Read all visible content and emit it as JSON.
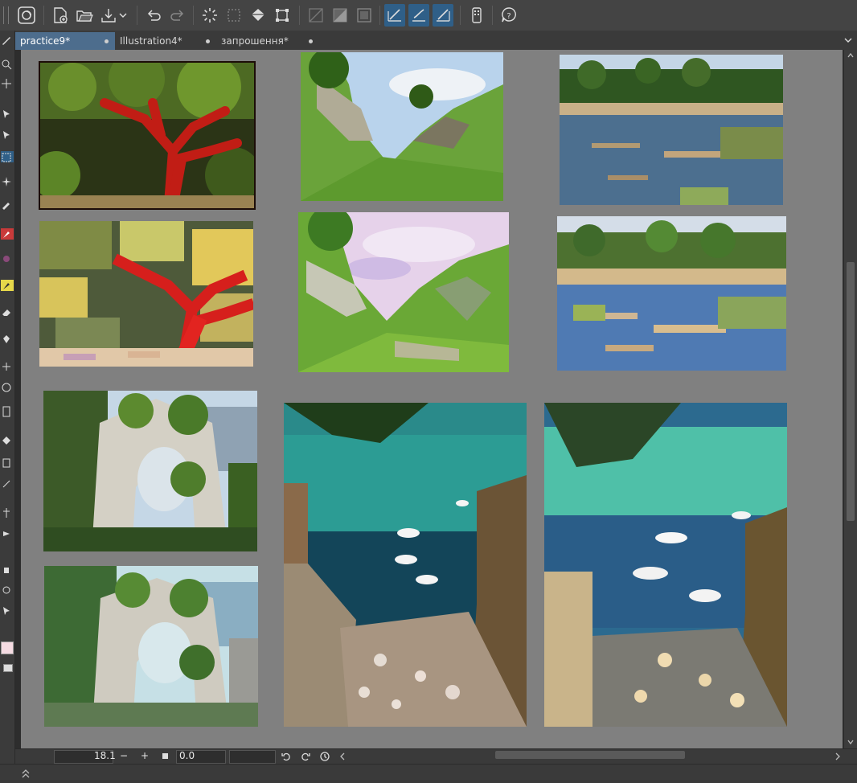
{
  "tabs": [
    {
      "label": "practice9*",
      "active": true
    },
    {
      "label": "Illustration4*",
      "active": false
    },
    {
      "label": "запрошення*",
      "active": false
    }
  ],
  "toolbar_icons": [
    "app-logo-icon",
    "new-file-icon",
    "open-file-icon",
    "save-file-icon",
    "dropdown-icon",
    "undo-icon",
    "redo-icon",
    "loading-icon",
    "selection-icon",
    "fill-icon",
    "transform-icon",
    "clear-selection-icon",
    "grey-tone-icon",
    "border-icon",
    "snap-ruler-icon",
    "snap-special-ruler-icon",
    "snap-grid-icon",
    "device-icon",
    "help-icon"
  ],
  "status": {
    "zoom": "18.1",
    "rotation": "0.0",
    "minus": "−",
    "plus": "+"
  },
  "colors": {
    "accent": "#4d6d8d",
    "canvas_bg": "#808080",
    "toolbar_bg": "#444444"
  }
}
